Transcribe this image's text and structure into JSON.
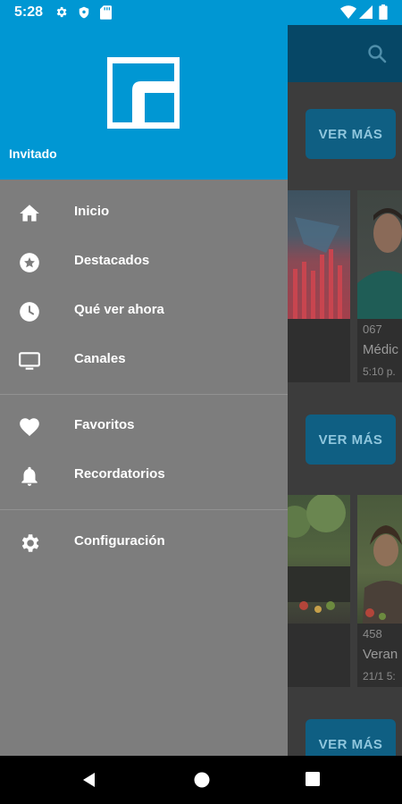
{
  "status_bar": {
    "time": "5:28",
    "left_icons": [
      "gear-icon",
      "shield-icon",
      "sd-card-icon"
    ],
    "right_icons": [
      "wifi-icon",
      "signal-icon",
      "battery-icon"
    ]
  },
  "drawer": {
    "user_label": "Invitado",
    "primary_items": [
      {
        "label": "Inicio",
        "icon": "home-icon"
      },
      {
        "label": "Destacados",
        "icon": "star-icon"
      },
      {
        "label": "Qué ver ahora",
        "icon": "clock-icon"
      },
      {
        "label": "Canales",
        "icon": "tv-icon"
      }
    ],
    "secondary_items": [
      {
        "label": "Favoritos",
        "icon": "heart-icon"
      },
      {
        "label": "Recordatorios",
        "icon": "bell-icon"
      }
    ],
    "settings_item": {
      "label": "Configuración",
      "icon": "gear-icon"
    }
  },
  "background": {
    "see_more_label": "VER MÁS",
    "cards": [
      {
        "number": "067",
        "title": "Médic",
        "time": "5:10 p."
      },
      {
        "number": "458",
        "title": "Veran",
        "time": "21/1 5:"
      }
    ]
  },
  "colors": {
    "brand": "#0097d3",
    "drawer": "#7d7d7d",
    "scrim_toolbar": "#064766"
  }
}
